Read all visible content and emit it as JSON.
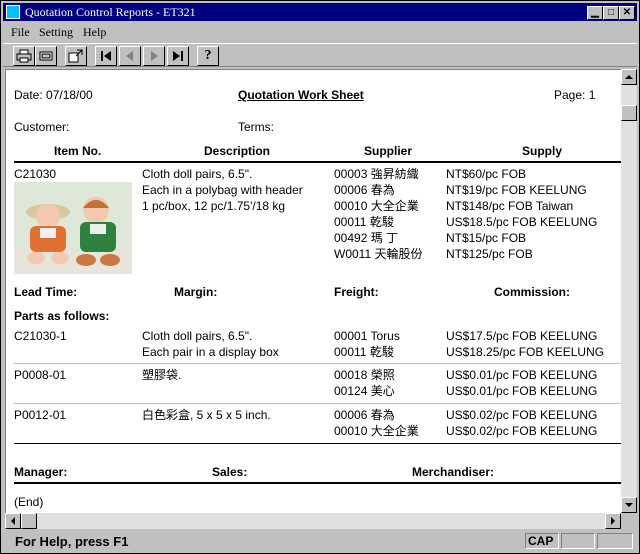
{
  "window": {
    "title": "Quotation Control Reports - ET321"
  },
  "menu": [
    "File",
    "Setting",
    "Help"
  ],
  "toolbar": {
    "icons": [
      "printer-icon",
      "print-preview-icon",
      "setup-icon",
      "first-page-icon",
      "prev-page-icon",
      "next-page-icon",
      "last-page-icon",
      "help-icon"
    ],
    "help_glyph": "?"
  },
  "report": {
    "date": "Date: 07/18/00",
    "title": "Quotation Work Sheet",
    "page": "Page: 1",
    "customer_label": "Customer:",
    "terms_label": "Terms:",
    "columns": [
      "Item No.",
      "Description",
      "Supplier",
      "Supply"
    ],
    "main_item": {
      "item_no": "C21030",
      "description": [
        "Cloth doll pairs, 6.5\".",
        "Each in a polybag with header",
        "1 pc/box, 12 pc/1.75'/18 kg"
      ],
      "suppliers": [
        "00003 強昇紡織",
        "00006 春為",
        "00010 大全企業",
        "00011 乾駿",
        "00492 瑪 丁",
        "W0011 天輪股份"
      ],
      "supply": [
        "NT$60/pc FOB",
        "NT$19/pc FOB KEELUNG",
        "NT$148/pc FOB Taiwan",
        "US$18.5/pc FOB KEELUNG",
        "NT$15/pc FOB",
        "NT$125/pc FOB"
      ]
    },
    "lead_time_label": "Lead Time:",
    "margin_label": "Margin:",
    "freight_label": "Freight:",
    "commission_label": "Commission:",
    "parts_label": "Parts as follows:",
    "parts": [
      {
        "item_no": "C21030-1",
        "description": [
          "Cloth doll pairs, 6.5\".",
          "Each pair in a display box"
        ],
        "suppliers": [
          "00001 Torus",
          "00011 乾駿"
        ],
        "supply": [
          "US$17.5/pc FOB KEELUNG",
          "US$18.25/pc FOB KEELUNG"
        ]
      },
      {
        "item_no": "P0008-01",
        "description": [
          "塑膠袋."
        ],
        "suppliers": [
          "00018 榮照",
          "00124 美心"
        ],
        "supply": [
          "US$0.01/pc FOB KEELUNG",
          "US$0.01/pc FOB KEELUNG"
        ]
      },
      {
        "item_no": "P0012-01",
        "description": [
          "白色彩盒, 5 x 5 x 5 inch."
        ],
        "suppliers": [
          "00006 春為",
          "00010 大全企業"
        ],
        "supply": [
          "US$0.02/pc FOB KEELUNG",
          "US$0.02/pc FOB KEELUNG"
        ]
      }
    ],
    "manager_label": "Manager:",
    "sales_label": "Sales:",
    "merchandiser_label": "Merchandiser:",
    "end_label": "(End)"
  },
  "status": {
    "help_text": "For Help, press F1",
    "cap": "CAP"
  }
}
